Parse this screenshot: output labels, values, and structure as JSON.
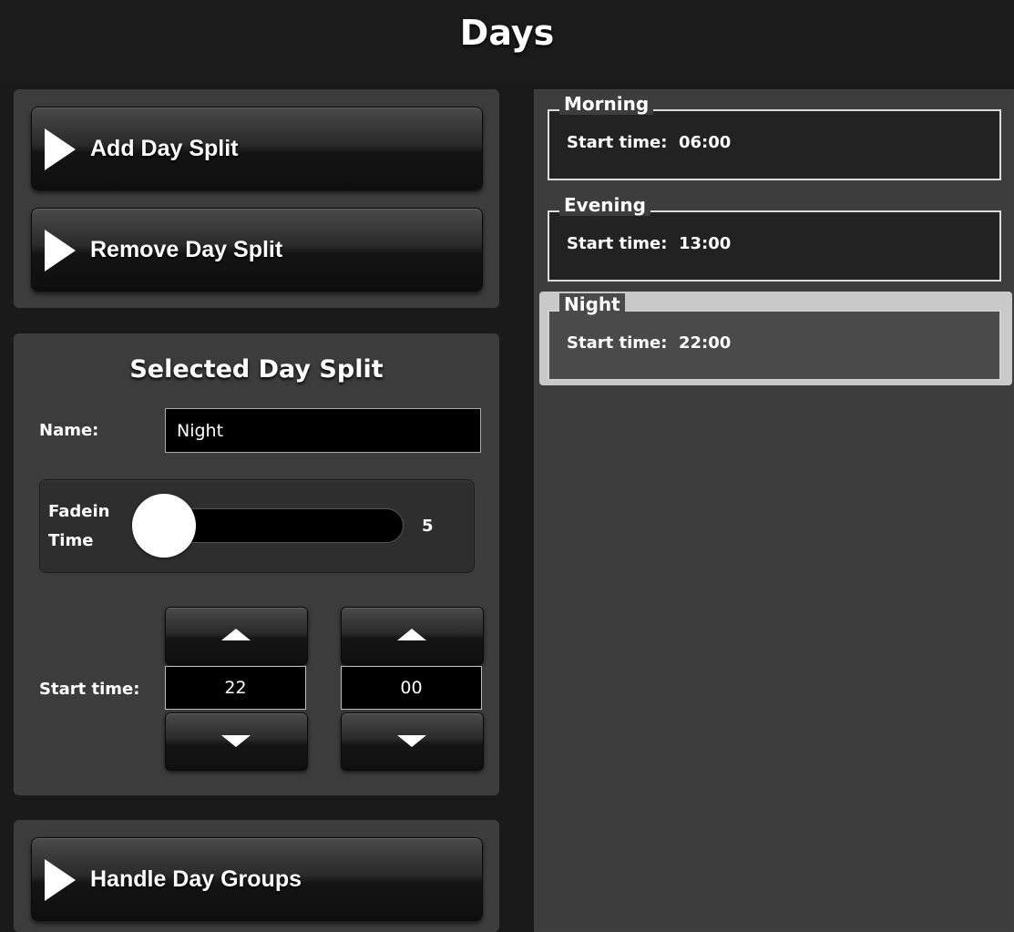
{
  "header": {
    "title": "Days"
  },
  "actions": {
    "add_label": "Add Day Split",
    "remove_label": "Remove Day Split",
    "groups_label": "Handle Day Groups"
  },
  "selected": {
    "title": "Selected Day Split",
    "name_label": "Name:",
    "name_value": "Night",
    "fadein_label_line1": "Fadein",
    "fadein_label_line2": "Time",
    "fadein_value": "5",
    "fadein_fraction": 0.0,
    "starttime_label": "Start time:",
    "hour": "22",
    "minute": "00"
  },
  "splits": [
    {
      "name": "Morning",
      "start_label": "Start time:",
      "start": "06:00",
      "selected": false
    },
    {
      "name": "Evening",
      "start_label": "Start time:",
      "start": "13:00",
      "selected": false
    },
    {
      "name": "Night",
      "start_label": "Start time:",
      "start": "22:00",
      "selected": true
    }
  ],
  "colors": {
    "background": "#1a1a1a",
    "panel": "#3c3c3c",
    "list_panel": "#3d3d3d",
    "selected_highlight": "#c9c9c9"
  },
  "icons": {
    "action_arrow": "play-triangle-icon",
    "spin_up": "triangle-up-icon",
    "spin_down": "triangle-down-icon"
  }
}
